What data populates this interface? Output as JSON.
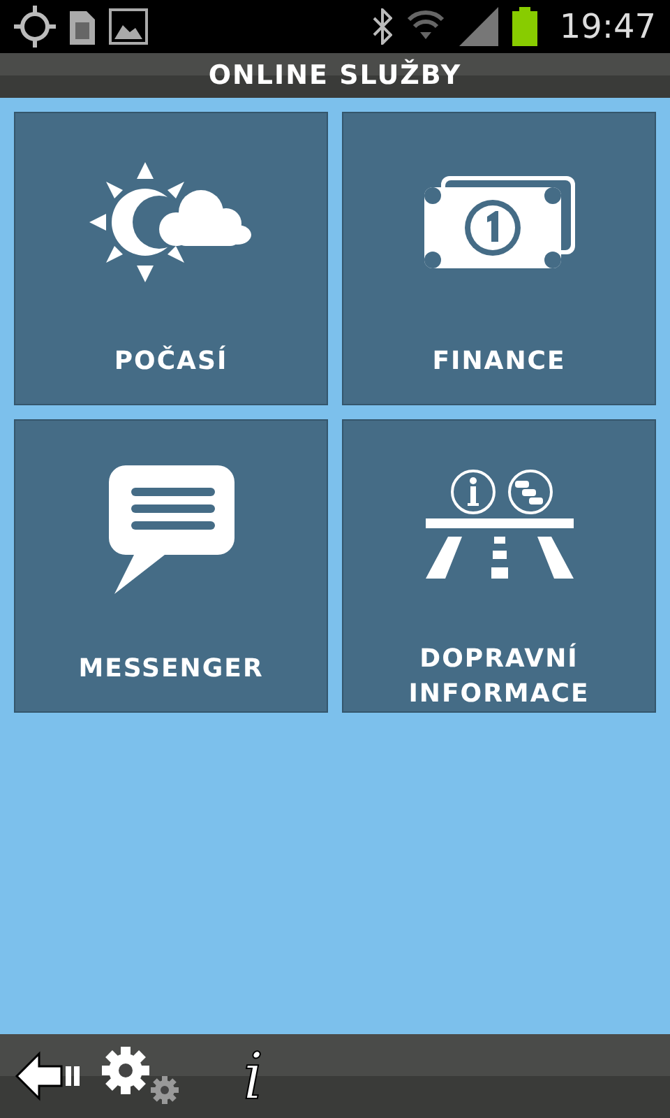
{
  "status_bar": {
    "time": "19:47"
  },
  "title": "ONLINE SLUŽBY",
  "tiles": [
    {
      "kind": "weather",
      "label": "POČASÍ"
    },
    {
      "kind": "finance",
      "label": "FINANCE"
    },
    {
      "kind": "messenger",
      "label": "MESSENGER"
    },
    {
      "kind": "traffic",
      "label": "DOPRAVNÍ INFORMACE"
    }
  ],
  "bottom_bar": {
    "info_glyph": "i"
  }
}
